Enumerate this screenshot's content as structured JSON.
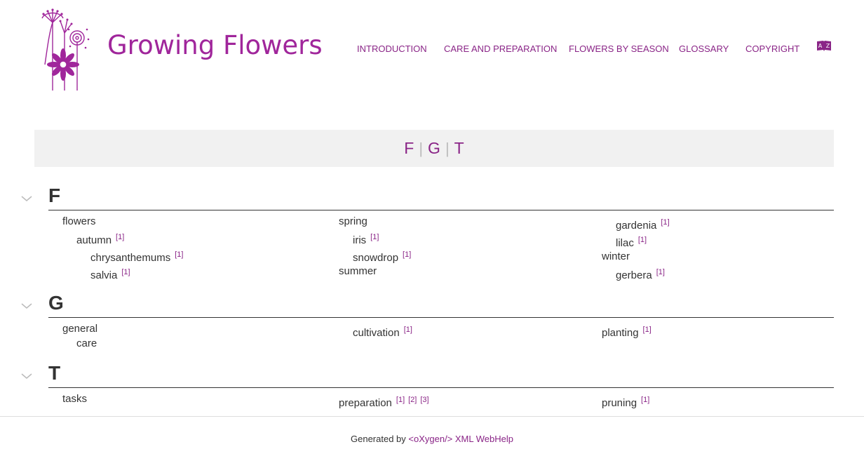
{
  "header": {
    "title": "Growing Flowers",
    "nav": [
      {
        "label": "INTRODUCTION"
      },
      {
        "label": "CARE AND PREPARATION"
      },
      {
        "label": "FLOWERS BY SEASON"
      },
      {
        "label": "GLOSSARY"
      },
      {
        "label": "COPYRIGHT"
      }
    ],
    "index_icon": "a-z-index-icon"
  },
  "letter_bar": {
    "letters": [
      "F",
      "G",
      "T"
    ],
    "separator": "|"
  },
  "sections": {
    "f": {
      "letter": "F",
      "flowers": "flowers",
      "autumn": "autumn",
      "chrysanthemums": "chrysanthemums",
      "salvia": "salvia",
      "spring": "spring",
      "iris": "iris",
      "snowdrop": "snowdrop",
      "summer": "summer",
      "gardenia": "gardenia",
      "lilac": "lilac",
      "winter": "winter",
      "gerbera": "gerbera"
    },
    "g": {
      "letter": "G",
      "general": "general",
      "care": "care",
      "cultivation": "cultivation",
      "planting": "planting"
    },
    "t": {
      "letter": "T",
      "tasks": "tasks",
      "preparation": "preparation",
      "pruning": "pruning"
    },
    "ref_labels": [
      "[1]",
      "[2]",
      "[3]"
    ]
  },
  "footer": {
    "prefix": "Generated by ",
    "link": "<oXygen/> XML WebHelp"
  },
  "colors": {
    "accent": "#8a2587",
    "title": "#a0269b",
    "bar": "#f1f1f1"
  }
}
